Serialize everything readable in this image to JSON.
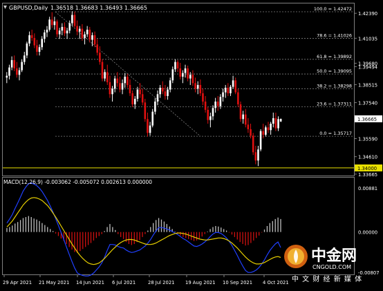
{
  "window": {
    "symbol_line": "GBPUSD,Daily",
    "ohlc_line": "1.36518 1.36683 1.36493 1.36665",
    "macd_label": "MACD(12,26,9) -0.003062 -0.005072 0.002613 0.000000"
  },
  "colors": {
    "background": "#000000",
    "bull": "#ffffff",
    "bear": "#e01010",
    "grid": "#808080",
    "axis_text": "#ffffff",
    "support": "#e8e000",
    "macd_hist_pos": "#c0c0c0",
    "macd_hist_neg": "#d01010",
    "macd_signal": "#e8d000",
    "macd_main": "#2040ff"
  },
  "chart_data": [
    {
      "type": "candlestick",
      "title": "GBPUSD,Daily",
      "x_tick_labels": [
        "29 Apr 2021",
        "21 May 2021",
        "14 Jun 2021",
        "6 Jul 2021",
        "28 Jul 2021",
        "19 Aug 2021",
        "10 Sep 2021",
        "4 Oct 2021"
      ],
      "y_tick_labels": [
        "1.42390",
        "1.41035",
        "1.39680",
        "1.39494",
        "1.38515",
        "1.37540",
        "1.35590",
        "1.34610",
        "1.33665"
      ],
      "current_price": "1.36665",
      "support_level": "1.34000",
      "ylim": [
        1.3366,
        1.4266
      ],
      "fibonacci": [
        {
          "label": "100.0 = 1.42472",
          "level": 1.42472
        },
        {
          "label": "78.6 = 1.41026",
          "level": 1.41026
        },
        {
          "label": "61.8 = 1.39892",
          "level": 1.39892
        },
        {
          "label": "50.0 = 1.39095",
          "level": 1.39095
        },
        {
          "label": "38.2 = 1.38298",
          "level": 1.38298
        },
        {
          "label": "23.6 = 1.37311",
          "level": 1.37311
        },
        {
          "label": "0.0 = 1.35717",
          "level": 1.35717
        }
      ],
      "candles": [
        [
          1.389,
          1.392,
          1.386,
          1.39
        ],
        [
          1.39,
          1.396,
          1.388,
          1.3945
        ],
        [
          1.3945,
          1.4005,
          1.393,
          1.3985
        ],
        [
          1.3985,
          1.401,
          1.3925,
          1.394
        ],
        [
          1.394,
          1.3975,
          1.389,
          1.3905
        ],
        [
          1.3905,
          1.3945,
          1.3875,
          1.393
        ],
        [
          1.393,
          1.399,
          1.392,
          1.3975
        ],
        [
          1.3975,
          1.403,
          1.396,
          1.401
        ],
        [
          1.401,
          1.4085,
          1.3995,
          1.4075
        ],
        [
          1.4075,
          1.414,
          1.406,
          1.412
        ],
        [
          1.412,
          1.415,
          1.409,
          1.4105
        ],
        [
          1.4105,
          1.413,
          1.405,
          1.4065
        ],
        [
          1.4065,
          1.4095,
          1.401,
          1.403
        ],
        [
          1.403,
          1.407,
          1.401,
          1.4055
        ],
        [
          1.4055,
          1.4115,
          1.404,
          1.41
        ],
        [
          1.41,
          1.415,
          1.408,
          1.4135
        ],
        [
          1.4135,
          1.417,
          1.411,
          1.415
        ],
        [
          1.415,
          1.422,
          1.414,
          1.4205
        ],
        [
          1.4205,
          1.4245,
          1.416,
          1.4175
        ],
        [
          1.4175,
          1.422,
          1.415,
          1.4195
        ],
        [
          1.4195,
          1.4205,
          1.411,
          1.4125
        ],
        [
          1.4125,
          1.416,
          1.41,
          1.4145
        ],
        [
          1.4145,
          1.4185,
          1.412,
          1.4165
        ],
        [
          1.4165,
          1.419,
          1.4115,
          1.413
        ],
        [
          1.413,
          1.416,
          1.41,
          1.4145
        ],
        [
          1.4145,
          1.42,
          1.413,
          1.4185
        ],
        [
          1.4185,
          1.425,
          1.417,
          1.423
        ],
        [
          1.423,
          1.4248,
          1.416,
          1.417
        ],
        [
          1.417,
          1.42,
          1.412,
          1.414
        ],
        [
          1.414,
          1.417,
          1.41,
          1.4155
        ],
        [
          1.4155,
          1.418,
          1.409,
          1.4105
        ],
        [
          1.4105,
          1.414,
          1.407,
          1.4125
        ],
        [
          1.4125,
          1.417,
          1.411,
          1.415
        ],
        [
          1.415,
          1.4165,
          1.408,
          1.4095
        ],
        [
          1.4095,
          1.4135,
          1.406,
          1.412
        ],
        [
          1.412,
          1.414,
          1.4055,
          1.407
        ],
        [
          1.407,
          1.41,
          1.401,
          1.4025
        ],
        [
          1.4025,
          1.406,
          1.396,
          1.3975
        ],
        [
          1.3975,
          1.399,
          1.387,
          1.3885
        ],
        [
          1.3885,
          1.3935,
          1.387,
          1.392
        ],
        [
          1.392,
          1.396,
          1.385,
          1.3865
        ],
        [
          1.3865,
          1.39,
          1.378,
          1.38
        ],
        [
          1.38,
          1.3845,
          1.376,
          1.383
        ],
        [
          1.383,
          1.39,
          1.381,
          1.3885
        ],
        [
          1.3885,
          1.392,
          1.384,
          1.386
        ],
        [
          1.386,
          1.3895,
          1.381,
          1.3825
        ],
        [
          1.3825,
          1.388,
          1.38,
          1.386
        ],
        [
          1.386,
          1.3915,
          1.3835,
          1.3895
        ],
        [
          1.3895,
          1.391,
          1.3835,
          1.385
        ],
        [
          1.385,
          1.388,
          1.379,
          1.3805
        ],
        [
          1.3805,
          1.382,
          1.373,
          1.3745
        ],
        [
          1.3745,
          1.379,
          1.372,
          1.3775
        ],
        [
          1.3775,
          1.384,
          1.376,
          1.3825
        ],
        [
          1.3825,
          1.386,
          1.378,
          1.38
        ],
        [
          1.38,
          1.383,
          1.374,
          1.3755
        ],
        [
          1.3755,
          1.3775,
          1.365,
          1.3665
        ],
        [
          1.3665,
          1.37,
          1.357,
          1.359
        ],
        [
          1.359,
          1.365,
          1.3575,
          1.363
        ],
        [
          1.363,
          1.372,
          1.362,
          1.3705
        ],
        [
          1.3705,
          1.378,
          1.369,
          1.376
        ],
        [
          1.376,
          1.382,
          1.374,
          1.38
        ],
        [
          1.38,
          1.385,
          1.378,
          1.3835
        ],
        [
          1.3835,
          1.387,
          1.38,
          1.3815
        ],
        [
          1.3815,
          1.385,
          1.377,
          1.379
        ],
        [
          1.379,
          1.384,
          1.377,
          1.3825
        ],
        [
          1.3825,
          1.389,
          1.381,
          1.3875
        ],
        [
          1.3875,
          1.395,
          1.386,
          1.3935
        ],
        [
          1.3935,
          1.399,
          1.392,
          1.3975
        ],
        [
          1.3975,
          1.3985,
          1.392,
          1.394
        ],
        [
          1.394,
          1.397,
          1.388,
          1.3895
        ],
        [
          1.3895,
          1.393,
          1.386,
          1.3915
        ],
        [
          1.3915,
          1.396,
          1.389,
          1.394
        ],
        [
          1.394,
          1.3955,
          1.387,
          1.3885
        ],
        [
          1.3885,
          1.392,
          1.385,
          1.3905
        ],
        [
          1.3905,
          1.393,
          1.3845,
          1.386
        ],
        [
          1.386,
          1.389,
          1.381,
          1.383
        ],
        [
          1.383,
          1.387,
          1.38,
          1.385
        ],
        [
          1.385,
          1.388,
          1.379,
          1.3805
        ],
        [
          1.3805,
          1.383,
          1.374,
          1.376
        ],
        [
          1.376,
          1.379,
          1.37,
          1.3715
        ],
        [
          1.3715,
          1.373,
          1.364,
          1.366
        ],
        [
          1.366,
          1.37,
          1.362,
          1.368
        ],
        [
          1.368,
          1.374,
          1.366,
          1.3725
        ],
        [
          1.3725,
          1.378,
          1.37,
          1.376
        ],
        [
          1.376,
          1.379,
          1.371,
          1.3735
        ],
        [
          1.3735,
          1.38,
          1.372,
          1.3785
        ],
        [
          1.3785,
          1.383,
          1.376,
          1.381
        ],
        [
          1.381,
          1.385,
          1.378,
          1.3835
        ],
        [
          1.3835,
          1.386,
          1.379,
          1.3805
        ],
        [
          1.3805,
          1.385,
          1.379,
          1.384
        ],
        [
          1.384,
          1.39,
          1.383,
          1.3875
        ],
        [
          1.3875,
          1.389,
          1.38,
          1.381
        ],
        [
          1.381,
          1.383,
          1.373,
          1.3745
        ],
        [
          1.3745,
          1.376,
          1.365,
          1.3665
        ],
        [
          1.3665,
          1.371,
          1.364,
          1.369
        ],
        [
          1.369,
          1.372,
          1.362,
          1.3635
        ],
        [
          1.3635,
          1.367,
          1.359,
          1.361
        ],
        [
          1.361,
          1.364,
          1.356,
          1.3575
        ],
        [
          1.3575,
          1.359,
          1.347,
          1.3485
        ],
        [
          1.3485,
          1.352,
          1.342,
          1.344
        ],
        [
          1.344,
          1.352,
          1.341,
          1.35
        ],
        [
          1.35,
          1.361,
          1.349,
          1.36
        ],
        [
          1.36,
          1.364,
          1.356,
          1.358
        ],
        [
          1.358,
          1.363,
          1.357,
          1.362
        ],
        [
          1.362,
          1.365,
          1.359,
          1.3605
        ],
        [
          1.3605,
          1.365,
          1.358,
          1.364
        ],
        [
          1.364,
          1.37,
          1.362,
          1.367
        ],
        [
          1.367,
          1.37,
          1.36,
          1.3615
        ],
        [
          1.3615,
          1.368,
          1.36,
          1.3665
        ],
        [
          1.3652,
          1.3668,
          1.3649,
          1.3666
        ]
      ]
    },
    {
      "type": "bar",
      "title": "MACD(12,26,9) -0.003062 -0.005072 0.002613 0.000000",
      "y_tick_labels": [
        "0.00881",
        "0.00000",
        "-0.00807"
      ],
      "ylim": [
        -0.00807,
        0.00881
      ],
      "histogram": [
        0.0008,
        0.001,
        0.0013,
        0.0017,
        0.002,
        0.0024,
        0.0028,
        0.003,
        0.0032,
        0.003,
        0.0027,
        0.0025,
        0.0022,
        0.0018,
        0.0014,
        0.001,
        0.0006,
        0.0002,
        -0.0003,
        -0.0008,
        -0.0013,
        -0.0018,
        -0.0024,
        -0.003,
        -0.0035,
        -0.004,
        -0.0042,
        -0.0038,
        -0.0034,
        -0.003,
        -0.0026,
        -0.0022,
        -0.0017,
        -0.0012,
        -0.0008,
        -0.0004,
        0.0002,
        0.001,
        0.0016,
        0.001,
        0.0004,
        -0.0004,
        -0.001,
        -0.0014,
        -0.002,
        -0.0024,
        -0.0026,
        -0.0024,
        -0.002,
        -0.0016,
        -0.001,
        -0.0004,
        0.0003,
        0.001,
        0.0018,
        0.0024,
        0.0028,
        0.0025,
        0.0021,
        0.0016,
        0.0011,
        0.0006,
        0.0001,
        -0.0003,
        -0.0007,
        -0.001,
        -0.0012,
        -0.0014,
        -0.0016,
        -0.0018,
        -0.0017,
        -0.0013,
        -0.0009,
        -0.0004,
        0.0001,
        0.0006,
        0.001,
        0.0012,
        0.0011,
        0.0009,
        0.0006,
        0.0003,
        -0.0001,
        -0.0005,
        -0.001,
        -0.0015,
        -0.002,
        -0.0024,
        -0.0027,
        -0.0026,
        -0.0022,
        -0.0017,
        -0.0012,
        -0.0007,
        -0.0001,
        0.0005,
        0.0012,
        0.0018,
        0.0022,
        0.0026,
        0.0029,
        0.0026
      ],
      "signal": [
        0.001,
        0.0016,
        0.0022,
        0.003,
        0.0038,
        0.0046,
        0.0054,
        0.006,
        0.0065,
        0.0068,
        0.0069,
        0.0068,
        0.0066,
        0.0063,
        0.0058,
        0.0053,
        0.0046,
        0.0038,
        0.003,
        0.0021,
        0.0012,
        0.0003,
        -0.0006,
        -0.0015,
        -0.0024,
        -0.0032,
        -0.004,
        -0.0047,
        -0.0053,
        -0.0058,
        -0.0062,
        -0.0064,
        -0.0065,
        -0.0064,
        -0.0062,
        -0.0058,
        -0.0053,
        -0.0047,
        -0.0041,
        -0.0035,
        -0.003,
        -0.0025,
        -0.0021,
        -0.0018,
        -0.0016,
        -0.0015,
        -0.0015,
        -0.0016,
        -0.0018,
        -0.002,
        -0.0022,
        -0.0024,
        -0.0025,
        -0.0025,
        -0.0024,
        -0.0022,
        -0.0019,
        -0.0016,
        -0.0013,
        -0.001,
        -0.0007,
        -0.0005,
        -0.0003,
        -0.0002,
        -0.0002,
        -0.0003,
        -0.0004,
        -0.0006,
        -0.0008,
        -0.001,
        -0.0012,
        -0.0014,
        -0.0015,
        -0.0016,
        -0.0016,
        -0.0015,
        -0.0014,
        -0.0013,
        -0.0012,
        -0.0012,
        -0.0013,
        -0.0015,
        -0.0018,
        -0.0022,
        -0.0027,
        -0.0032,
        -0.0038,
        -0.0044,
        -0.005,
        -0.0055,
        -0.0059,
        -0.0062,
        -0.0064,
        -0.0064,
        -0.0063,
        -0.0061,
        -0.0058,
        -0.0055,
        -0.0052,
        -0.005,
        -0.0049,
        -0.0051
      ],
      "main": [
        0.0018,
        0.0026,
        0.0035,
        0.0047,
        0.0058,
        0.007,
        0.0082,
        0.009,
        0.0097,
        0.0098,
        0.0096,
        0.0093,
        0.0088,
        0.0081,
        0.0072,
        0.0063,
        0.0052,
        0.004,
        0.0027,
        0.0013,
        -0.0001,
        -0.0015,
        -0.003,
        -0.0045,
        -0.0059,
        -0.0072,
        -0.0082,
        -0.0085,
        -0.0087,
        -0.0088,
        -0.0088,
        -0.0086,
        -0.0082,
        -0.0076,
        -0.007,
        -0.0062,
        -0.0051,
        -0.0037,
        -0.0025,
        -0.0025,
        -0.0026,
        -0.0029,
        -0.0031,
        -0.0032,
        -0.0036,
        -0.0039,
        -0.0041,
        -0.004,
        -0.0038,
        -0.0036,
        -0.0032,
        -0.0028,
        -0.0022,
        -0.0015,
        -0.0006,
        0.0002,
        0.0009,
        0.0009,
        0.0008,
        0.0006,
        0.0004,
        0.0001,
        -0.0002,
        -0.0005,
        -0.0009,
        -0.0013,
        -0.0016,
        -0.002,
        -0.0024,
        -0.0028,
        -0.0029,
        -0.0027,
        -0.0024,
        -0.002,
        -0.0015,
        -0.0009,
        -0.0004,
        -0.0001,
        -0.0001,
        -0.0003,
        -0.0007,
        -0.0012,
        -0.0019,
        -0.0027,
        -0.0037,
        -0.0047,
        -0.0058,
        -0.0068,
        -0.0077,
        -0.0081,
        -0.0081,
        -0.0079,
        -0.0076,
        -0.0071,
        -0.0064,
        -0.0056,
        -0.0046,
        -0.0037,
        -0.003,
        -0.0024,
        -0.002,
        -0.0031
      ]
    }
  ],
  "watermark": {
    "brand": "中金网",
    "url": "CNGOLD.COM",
    "tagline": "中 文 财 经 新 媒 体"
  }
}
